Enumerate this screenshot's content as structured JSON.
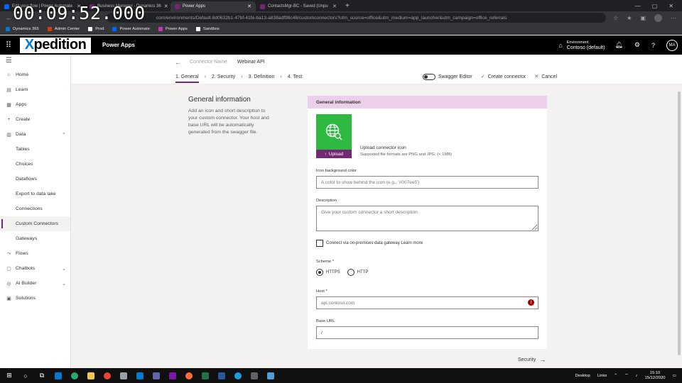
{
  "overlay": {
    "timer": "00:09:52.000"
  },
  "browser": {
    "tabs": [
      {
        "label": "Edit your flow | Power Automate",
        "active": false,
        "color": "#0066ff"
      },
      {
        "label": "Business Manager - Dynamics 36",
        "active": false,
        "color": "#742774"
      },
      {
        "label": "Power Apps",
        "active": true,
        "color": "#742774"
      },
      {
        "label": "ContactsMgr-BC - Saved (Unpu",
        "active": false,
        "color": "#742774"
      }
    ],
    "new_tab": "+",
    "url": "com/environments/Default-8d0632b1-47bf-41fe-ba13-a838adf98c48/customconnectors?utm_source=office&utm_medium=app_launcher&utm_campaign=office_referrals",
    "bookmarks": [
      {
        "label": "Dynamics 365",
        "color": "#0078d4"
      },
      {
        "label": "Admin Center",
        "color": "#d83b01"
      },
      {
        "label": "Prod",
        "color": "#ffffff"
      },
      {
        "label": "Power Automate",
        "color": "#0066ff"
      },
      {
        "label": "Power Apps",
        "color": "#c239b3"
      },
      {
        "label": "Sandbox",
        "color": "#ffffff"
      }
    ]
  },
  "header": {
    "logo_first": "X",
    "logo_rest": "pedition",
    "app_name": "Power Apps",
    "environment_label": "Environment",
    "environment_value": "Contoso (default)",
    "avatar_initials": "MA"
  },
  "sidebar": {
    "items": [
      {
        "label": "Home",
        "icon": "⌂",
        "name": "home"
      },
      {
        "label": "Learn",
        "icon": "▤",
        "name": "learn"
      },
      {
        "label": "Apps",
        "icon": "▦",
        "name": "apps"
      },
      {
        "label": "Create",
        "icon": "+",
        "name": "create"
      },
      {
        "label": "Data",
        "icon": "▥",
        "name": "data",
        "chevron": "⌃"
      },
      {
        "label": "Tables",
        "name": "tables",
        "sub": true
      },
      {
        "label": "Choices",
        "name": "choices",
        "sub": true
      },
      {
        "label": "Dataflows",
        "name": "dataflows",
        "sub": true
      },
      {
        "label": "Export to data lake",
        "name": "export-to-data-lake",
        "sub": true
      },
      {
        "label": "Connections",
        "name": "connections",
        "sub": true
      },
      {
        "label": "Custom Connectors",
        "name": "custom-connectors",
        "sub": true,
        "selected": true
      },
      {
        "label": "Gateways",
        "name": "gateways",
        "sub": true
      },
      {
        "label": "Flows",
        "icon": "⤳",
        "name": "flows"
      },
      {
        "label": "Chatbots",
        "icon": "▢",
        "name": "chatbots",
        "chevron": "⌄"
      },
      {
        "label": "AI Builder",
        "icon": "◎",
        "name": "ai-builder",
        "chevron": "⌄"
      },
      {
        "label": "Solutions",
        "icon": "▣",
        "name": "solutions"
      }
    ]
  },
  "connector": {
    "name_label": "Connector Name",
    "name_value": "Webinar API"
  },
  "steps": [
    {
      "label": "1. General",
      "active": true
    },
    {
      "label": "2. Security",
      "active": false
    },
    {
      "label": "3. Definition",
      "active": false
    },
    {
      "label": "4. Test",
      "active": false
    }
  ],
  "actions": {
    "swagger": "Swagger Editor",
    "create": "Create connector",
    "cancel": "Cancel"
  },
  "general": {
    "title": "General information",
    "description": "Add an icon and short description to your custom connector. Your host and base URL will be automatically generated from the swagger file.",
    "card_header": "General information",
    "upload_button": "Upload",
    "upload_title": "Upload connector icon",
    "upload_sub": "Supported file formats are PNG and JPG. (< 1MB)",
    "icon_color_label": "Icon background color",
    "icon_color_placeholder": "A color to show behind the icon (e.g., '#007ee5')",
    "description_label": "Description",
    "description_placeholder": "Give your custom connector a short description",
    "gateway_label": "Connect via on-premises data gateway Learn more",
    "scheme_label": "Scheme *",
    "scheme_https": "HTTPS",
    "scheme_http": "HTTP",
    "host_label": "Host *",
    "host_placeholder": "api.contoso.com",
    "base_url_label": "Base URL",
    "base_url_value": "/",
    "next_label": "Security"
  },
  "taskbar": {
    "desktop": "Desktop",
    "links": "Links",
    "time": "15:10",
    "date": "15/12/2020"
  }
}
